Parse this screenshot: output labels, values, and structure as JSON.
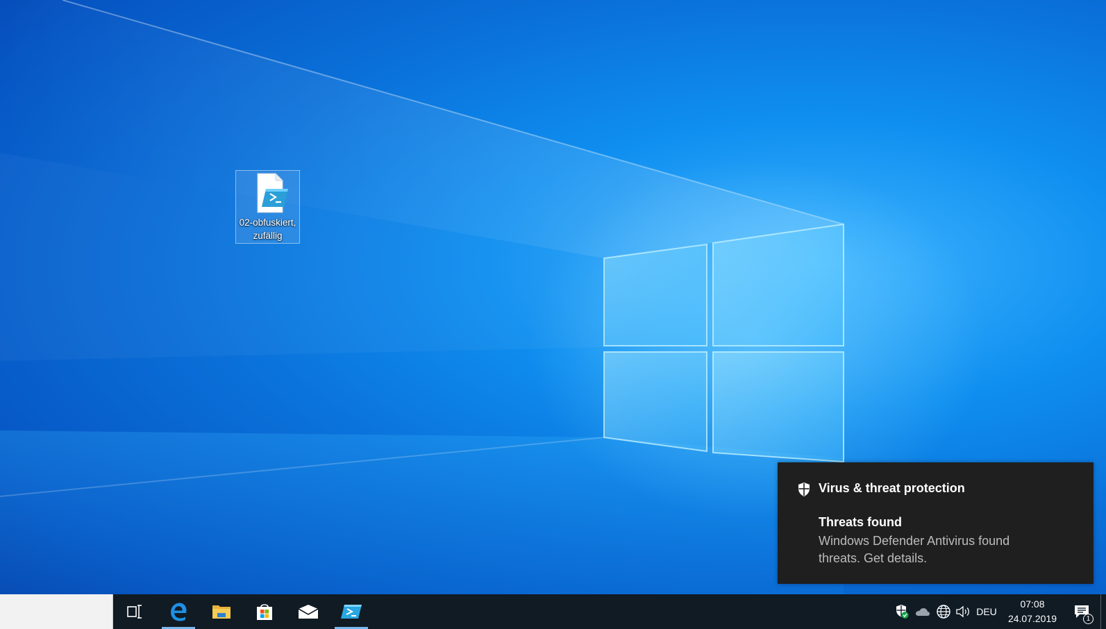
{
  "desktop": {
    "icons": [
      {
        "label": "02-obfuskiert,\nzufällig",
        "icon": "powershell-script-file-icon"
      }
    ]
  },
  "toast": {
    "app_name": "Virus & threat protection",
    "app_icon": "shield-icon",
    "title": "Threats found",
    "body": "Windows Defender Antivirus found threats. Get details."
  },
  "taskbar": {
    "search_placeholder": "",
    "buttons": [
      {
        "name": "task-view-icon",
        "active": false
      },
      {
        "name": "edge-icon",
        "active": true
      },
      {
        "name": "file-explorer-icon",
        "active": false
      },
      {
        "name": "microsoft-store-icon",
        "active": false
      },
      {
        "name": "mail-icon",
        "active": false
      },
      {
        "name": "powershell-icon",
        "active": true
      }
    ],
    "tray": {
      "icons": [
        "defender-shield-icon",
        "onedrive-cloud-icon",
        "network-globe-icon",
        "volume-icon"
      ],
      "language": "DEU",
      "time": "07:08",
      "date": "24.07.2019",
      "notification_count": "1"
    }
  },
  "colors": {
    "taskbar_bg": "#101b24",
    "toast_bg": "#1f1f1f",
    "active_indicator": "#79b8ec",
    "desktop_blue": "#0a6fd8"
  }
}
